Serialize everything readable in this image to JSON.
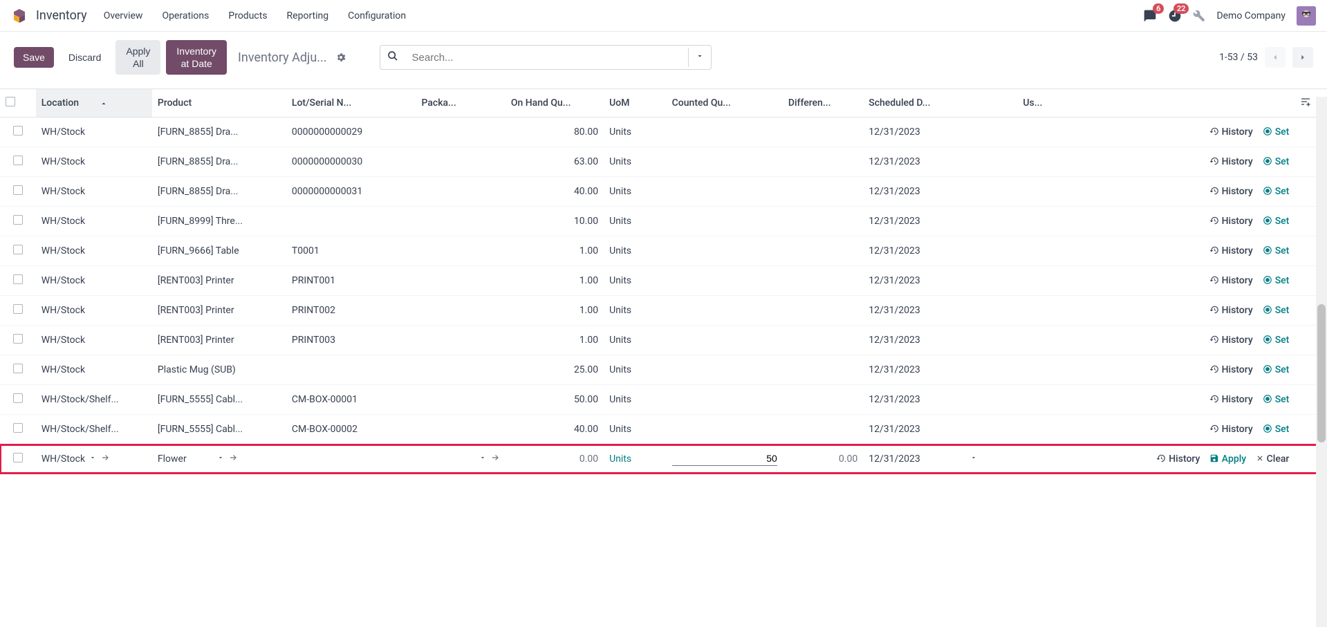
{
  "nav": {
    "app_name": "Inventory",
    "links": [
      "Overview",
      "Operations",
      "Products",
      "Reporting",
      "Configuration"
    ],
    "msg_badge": "6",
    "activity_badge": "22",
    "company": "Demo Company"
  },
  "controls": {
    "save": "Save",
    "discard": "Discard",
    "apply_all": "Apply\nAll",
    "inventory_at_date": "Inventory\nat Date",
    "breadcrumb": "Inventory Adju...",
    "search_placeholder": "Search...",
    "pager": "1-53 / 53"
  },
  "columns": {
    "location": "Location",
    "product": "Product",
    "lot": "Lot/Serial N...",
    "package": "Packa...",
    "onhand": "On Hand Qu...",
    "uom": "UoM",
    "counted": "Counted Qu...",
    "difference": "Differen...",
    "scheduled": "Scheduled D...",
    "user": "Us..."
  },
  "rows": [
    {
      "location": "WH/Stock",
      "product": "[FURN_8855] Dra...",
      "lot": "0000000000029",
      "package": "",
      "onhand": "80.00",
      "uom": "Units",
      "counted": "",
      "difference": "",
      "scheduled": "12/31/2023",
      "user": ""
    },
    {
      "location": "WH/Stock",
      "product": "[FURN_8855] Dra...",
      "lot": "0000000000030",
      "package": "",
      "onhand": "63.00",
      "uom": "Units",
      "counted": "",
      "difference": "",
      "scheduled": "12/31/2023",
      "user": ""
    },
    {
      "location": "WH/Stock",
      "product": "[FURN_8855] Dra...",
      "lot": "0000000000031",
      "package": "",
      "onhand": "40.00",
      "uom": "Units",
      "counted": "",
      "difference": "",
      "scheduled": "12/31/2023",
      "user": ""
    },
    {
      "location": "WH/Stock",
      "product": "[FURN_8999] Thre...",
      "lot": "",
      "package": "",
      "onhand": "10.00",
      "uom": "Units",
      "counted": "",
      "difference": "",
      "scheduled": "12/31/2023",
      "user": ""
    },
    {
      "location": "WH/Stock",
      "product": "[FURN_9666] Table",
      "lot": "T0001",
      "package": "",
      "onhand": "1.00",
      "uom": "Units",
      "counted": "",
      "difference": "",
      "scheduled": "12/31/2023",
      "user": ""
    },
    {
      "location": "WH/Stock",
      "product": "[RENT003] Printer",
      "lot": "PRINT001",
      "package": "",
      "onhand": "1.00",
      "uom": "Units",
      "counted": "",
      "difference": "",
      "scheduled": "12/31/2023",
      "user": ""
    },
    {
      "location": "WH/Stock",
      "product": "[RENT003] Printer",
      "lot": "PRINT002",
      "package": "",
      "onhand": "1.00",
      "uom": "Units",
      "counted": "",
      "difference": "",
      "scheduled": "12/31/2023",
      "user": ""
    },
    {
      "location": "WH/Stock",
      "product": "[RENT003] Printer",
      "lot": "PRINT003",
      "package": "",
      "onhand": "1.00",
      "uom": "Units",
      "counted": "",
      "difference": "",
      "scheduled": "12/31/2023",
      "user": ""
    },
    {
      "location": "WH/Stock",
      "product": "Plastic Mug (SUB)",
      "lot": "",
      "package": "",
      "onhand": "25.00",
      "uom": "Units",
      "counted": "",
      "difference": "",
      "scheduled": "12/31/2023",
      "user": ""
    },
    {
      "location": "WH/Stock/Shelf...",
      "product": "[FURN_5555] Cabl...",
      "lot": "CM-BOX-00001",
      "package": "",
      "onhand": "50.00",
      "uom": "Units",
      "counted": "",
      "difference": "",
      "scheduled": "12/31/2023",
      "user": ""
    },
    {
      "location": "WH/Stock/Shelf...",
      "product": "[FURN_5555] Cabl...",
      "lot": "CM-BOX-00002",
      "package": "",
      "onhand": "40.00",
      "uom": "Units",
      "counted": "",
      "difference": "",
      "scheduled": "12/31/2023",
      "user": ""
    }
  ],
  "edit_row": {
    "location": "WH/Stock",
    "product": "Flower",
    "onhand": "0.00",
    "uom": "Units",
    "counted_value": "50",
    "difference": "0.00",
    "scheduled": "12/31/2023"
  },
  "row_actions": {
    "history": "History",
    "set": "Set",
    "apply": "Apply",
    "clear": "Clear"
  }
}
